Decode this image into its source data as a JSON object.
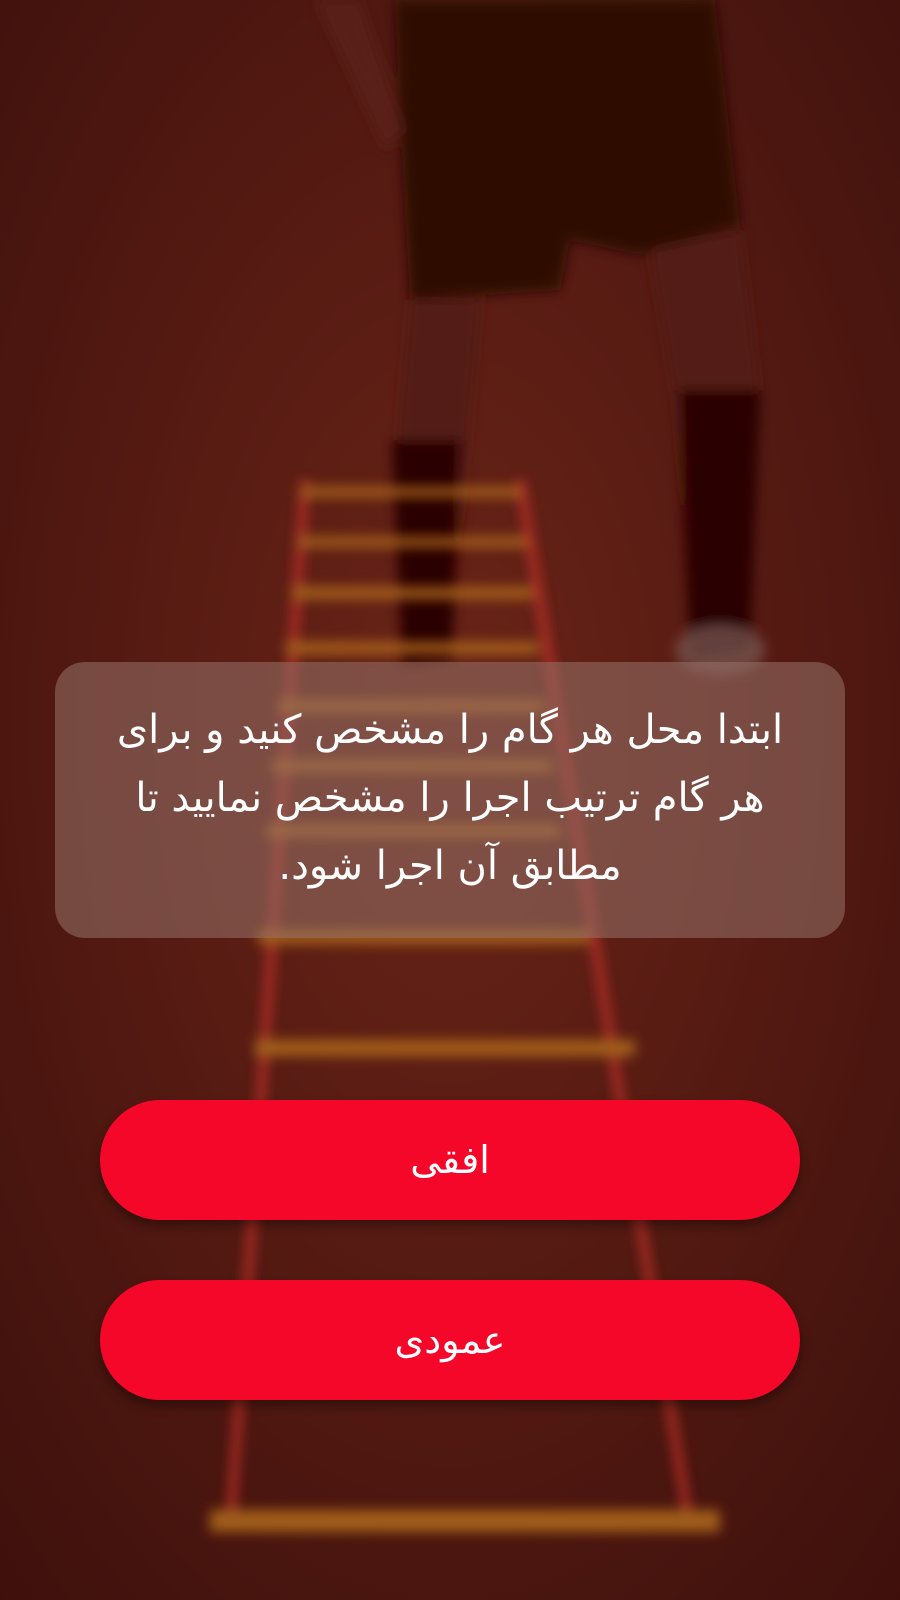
{
  "instruction": {
    "text": "ابتدا محل هر گام را مشخص کنید و برای هر گام ترتیب اجرا را مشخص نمایید تا مطابق آن اجرا شود."
  },
  "buttons": {
    "horizontal_label": "افقی",
    "vertical_label": "عمودی"
  },
  "colors": {
    "button": "#f5072a",
    "button_text": "#ffffff",
    "overlay": "#4a1410",
    "card": "rgba(150,115,105,0.55)"
  }
}
